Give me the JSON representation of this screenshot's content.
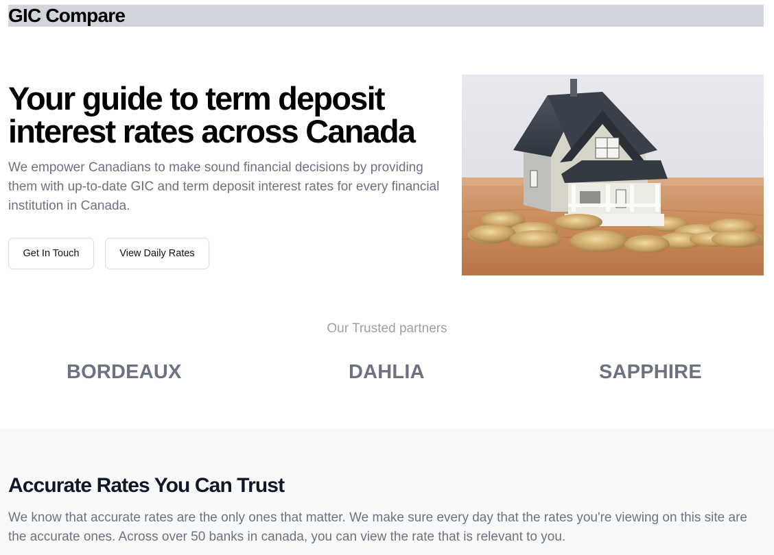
{
  "header": {
    "brand": "GIC Compare"
  },
  "hero": {
    "title_line1": "Your guide to term deposit",
    "title_line2": "interest rates across Canada",
    "description": "We empower Canadians to make sound financial decisions by providing them with up-to-date GIC and term deposit interest rates for every financial institution in Canada.",
    "buttons": {
      "get_in_touch": "Get In Touch",
      "view_daily_rates": "View Daily Rates"
    },
    "image_icon": "house-on-coins-photo"
  },
  "partners": {
    "title": "Our Trusted partners",
    "items": [
      "BORDEAUX",
      "DAHLIA",
      "SAPPHIRE"
    ]
  },
  "trust": {
    "title": "Accurate Rates You Can Trust",
    "description": "We know that accurate rates are the only ones that matter. We make sure every day that the rates you're viewing on this site are the accurate ones. Across over 50 banks in canada, you can view the rate that is relevant to you."
  },
  "colors": {
    "header_bar": "#d3d5dd",
    "muted_text": "#6b7280",
    "section_bg": "#f8f9fb"
  }
}
